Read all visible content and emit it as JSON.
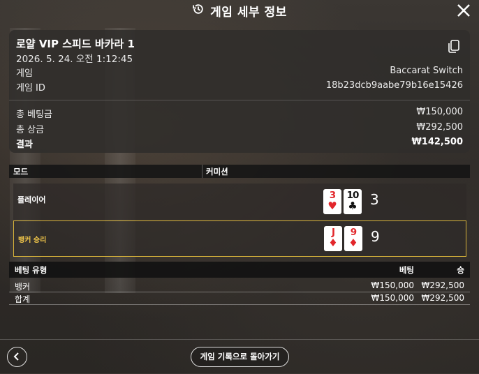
{
  "header": {
    "title": "게임 세부 정보",
    "history_icon": "history-icon",
    "close_icon": "close-icon"
  },
  "summary": {
    "game_name": "로얄 VIP 스피드 바카라 1",
    "datetime": "2026. 5. 24. 오전 1:12:45",
    "copy_icon": "copy-icon",
    "game_label": "게임",
    "game_value": "Baccarat Switch",
    "game_id_label": "게임 ID",
    "game_id_value": "18b23dcb9aabe79b16e15426",
    "total_bet_label": "총 베팅금",
    "total_bet_value": "₩150,000",
    "total_win_label": "총 상금",
    "total_win_value": "₩292,500",
    "result_label": "결과",
    "result_value": "₩142,500"
  },
  "mode_bar": {
    "mode": "모드",
    "commission": "커미션"
  },
  "hands": {
    "player": {
      "label": "플레이어",
      "score": "3",
      "cards": [
        {
          "rank": "3",
          "suit": "♥",
          "color": "#e2262b"
        },
        {
          "rank": "10",
          "suit": "♣",
          "color": "#111111"
        }
      ]
    },
    "banker": {
      "label": "뱅커 승리",
      "score": "9",
      "highlight_color": "#d6b23a",
      "cards": [
        {
          "rank": "J",
          "suit": "♦",
          "color": "#e2262b"
        },
        {
          "rank": "9",
          "suit": "♦",
          "color": "#e2262b"
        }
      ]
    }
  },
  "bet_table": {
    "headers": {
      "type": "베팅 유형",
      "bet": "베팅",
      "win": "승"
    },
    "rows": [
      {
        "type": "뱅커",
        "bet": "₩150,000",
        "win": "₩292,500"
      },
      {
        "type": "합계",
        "bet": "₩150,000",
        "win": "₩292,500"
      }
    ]
  },
  "footer": {
    "back_icon": "chevron-left-icon",
    "return_label": "게임 기록으로 돌아가기"
  }
}
